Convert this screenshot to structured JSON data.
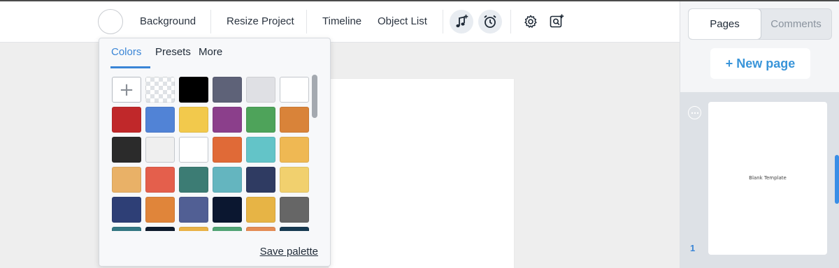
{
  "toolbar": {
    "background_label": "Background",
    "resize_label": "Resize Project",
    "timeline_label": "Timeline",
    "object_list_label": "Object List",
    "icons": [
      "music-add-icon",
      "alarm-clock-icon",
      "gear-icon",
      "search-add-icon"
    ]
  },
  "color_popup": {
    "tabs": [
      "Colors",
      "Presets",
      "More"
    ],
    "active_tab": "Colors",
    "save_label": "Save palette",
    "add_glyph": "+",
    "swatches": [
      [
        "#add",
        "#transparent",
        "#000000",
        "#5e6278",
        "#dfe0e4",
        "#ffffff"
      ],
      [
        "#c0282a",
        "#5183d6",
        "#f2c94c",
        "#8b3f8b",
        "#4ea35a",
        "#d98339"
      ],
      [
        "#2b2b2b",
        "#efefef",
        "#ffffff",
        "#e06a37",
        "#63c4c8",
        "#efb853"
      ],
      [
        "#e9b167",
        "#e45f4c",
        "#3c7c74",
        "#64b5bf",
        "#2f3b62",
        "#f1d06e"
      ],
      [
        "#2e3f76",
        "#e0853a",
        "#515f94",
        "#0b1730",
        "#e7b445",
        "#666666"
      ],
      [
        "#347783",
        "#0f1b2d",
        "#eab246",
        "#52a475",
        "#e48c55",
        "#173a52"
      ]
    ],
    "selected_swatches": [
      "0-5",
      "2-2"
    ]
  },
  "right_panel": {
    "tabs": [
      "Pages",
      "Comments"
    ],
    "active_tab": "Pages",
    "new_page_label": "+ New page",
    "pages": [
      {
        "number": "1",
        "label": "Blank Template"
      }
    ]
  },
  "colors": {
    "accent": "#3a85d6",
    "new_page_text": "#3a95d9"
  }
}
